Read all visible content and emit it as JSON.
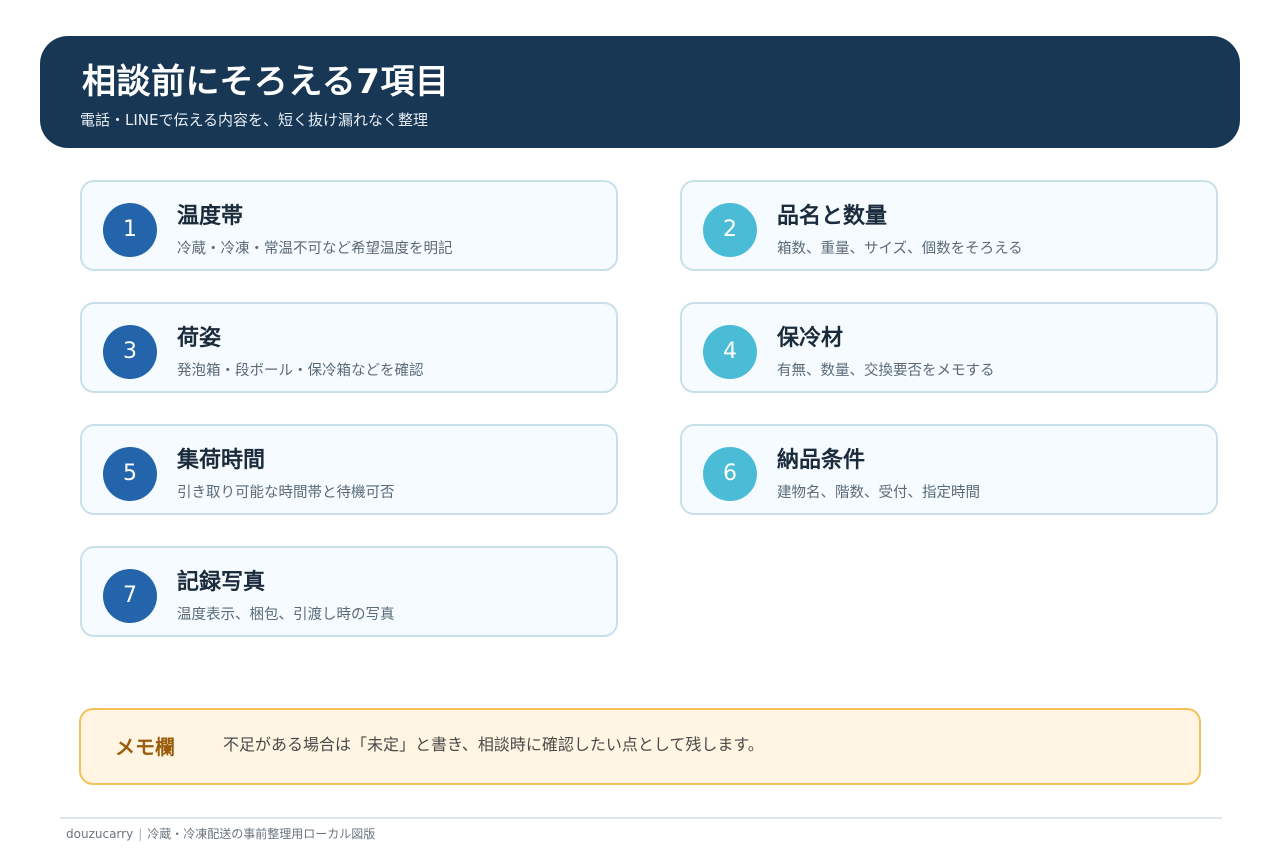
{
  "header": {
    "title": "相談前にそろえる7項目",
    "subtitle": "電話・LINEで伝える内容を、短く抜け漏れなく整理"
  },
  "items": [
    {
      "number": "1",
      "title": "温度帯",
      "description": "冷蔵・冷凍・常温不可など希望温度を明記"
    },
    {
      "number": "2",
      "title": "品名と数量",
      "description": "箱数、重量、サイズ、個数をそろえる"
    },
    {
      "number": "3",
      "title": "荷姿",
      "description": "発泡箱・段ボール・保冷箱などを確認"
    },
    {
      "number": "4",
      "title": "保冷材",
      "description": "有無、数量、交換要否をメモする"
    },
    {
      "number": "5",
      "title": "集荷時間",
      "description": "引き取り可能な時間帯と待機可否"
    },
    {
      "number": "6",
      "title": "納品条件",
      "description": "建物名、階数、受付、指定時間"
    },
    {
      "number": "7",
      "title": "記録写真",
      "description": "温度表示、梱包、引渡し時の写真"
    }
  ],
  "memo": {
    "label": "メモ欄",
    "text": "不足がある場合は「未定」と書き、相談時に確認したい点として残します。"
  },
  "footer": {
    "brand": "douzucarry",
    "separator": "|",
    "caption": "冷蔵・冷凍配送の事前整理用ローカル図版"
  },
  "colors": {
    "header_bg": "#183754",
    "badge_dark": "#2364aa",
    "badge_light": "#4bbcd6",
    "card_border": "#c9e0ea",
    "memo_bg": "#fff5e2",
    "memo_border": "#f2c35a",
    "memo_label": "#9a5d0e"
  }
}
